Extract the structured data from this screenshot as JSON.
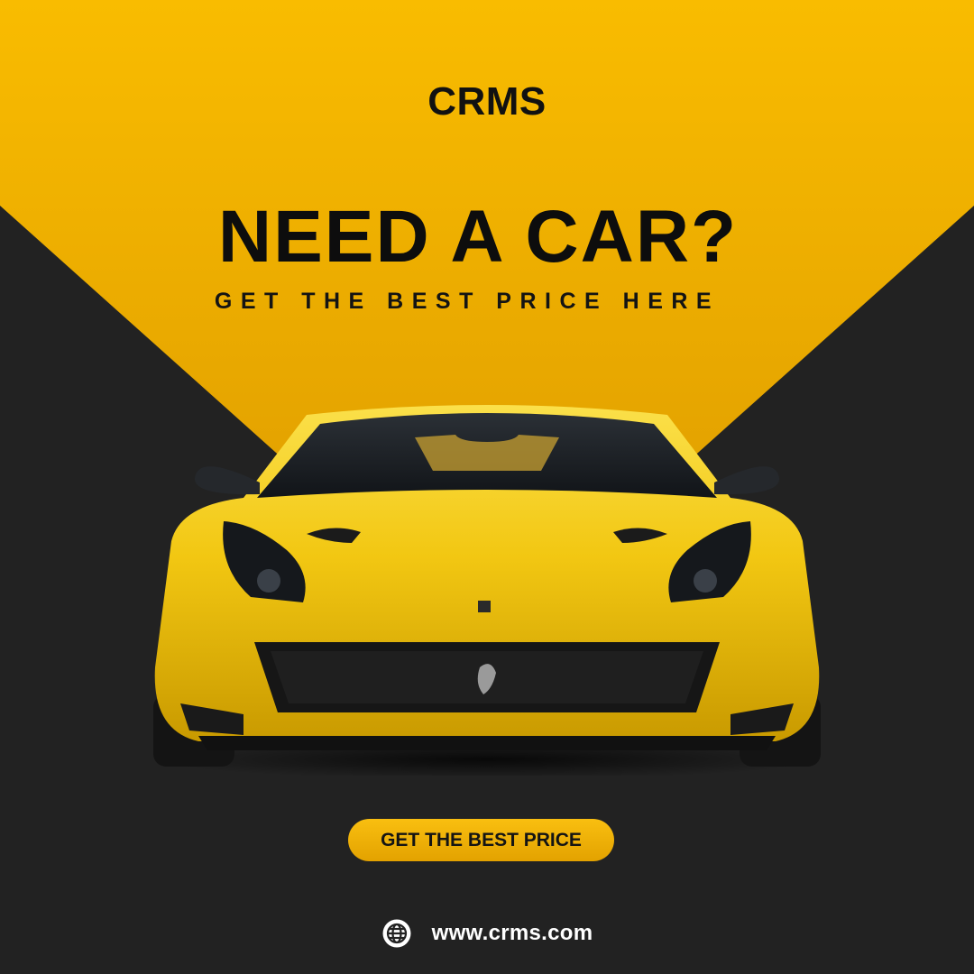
{
  "brand": {
    "name": "CRMS",
    "accent_color": "#F5B400",
    "dark_color": "#222222"
  },
  "hero": {
    "headline": "NEED A CAR?",
    "tagline": "GET THE BEST PRICE HERE"
  },
  "cta": {
    "label": "GET THE BEST PRICE"
  },
  "footer": {
    "website": "www.crms.com",
    "icon": "globe-icon"
  }
}
